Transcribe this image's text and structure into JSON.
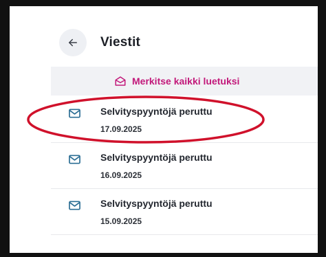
{
  "header": {
    "back_icon": "arrow-left-icon",
    "title": "Viestit"
  },
  "actions": {
    "mark_all_read_label": "Merkitse kaikki luetuksi",
    "mark_all_read_icon": "envelope-open-icon",
    "accent_color": "#c2187a"
  },
  "messages": [
    {
      "icon": "envelope-icon",
      "subject": "Selvityspyyntöjä peruttu",
      "date": "17.09.2025"
    },
    {
      "icon": "envelope-icon",
      "subject": "Selvityspyyntöjä peruttu",
      "date": "16.09.2025"
    },
    {
      "icon": "envelope-icon",
      "subject": "Selvityspyyntöjä peruttu",
      "date": "15.09.2025"
    }
  ],
  "annotation": {
    "highlight_color": "#d0112b",
    "highlighted_message_index": 0
  }
}
